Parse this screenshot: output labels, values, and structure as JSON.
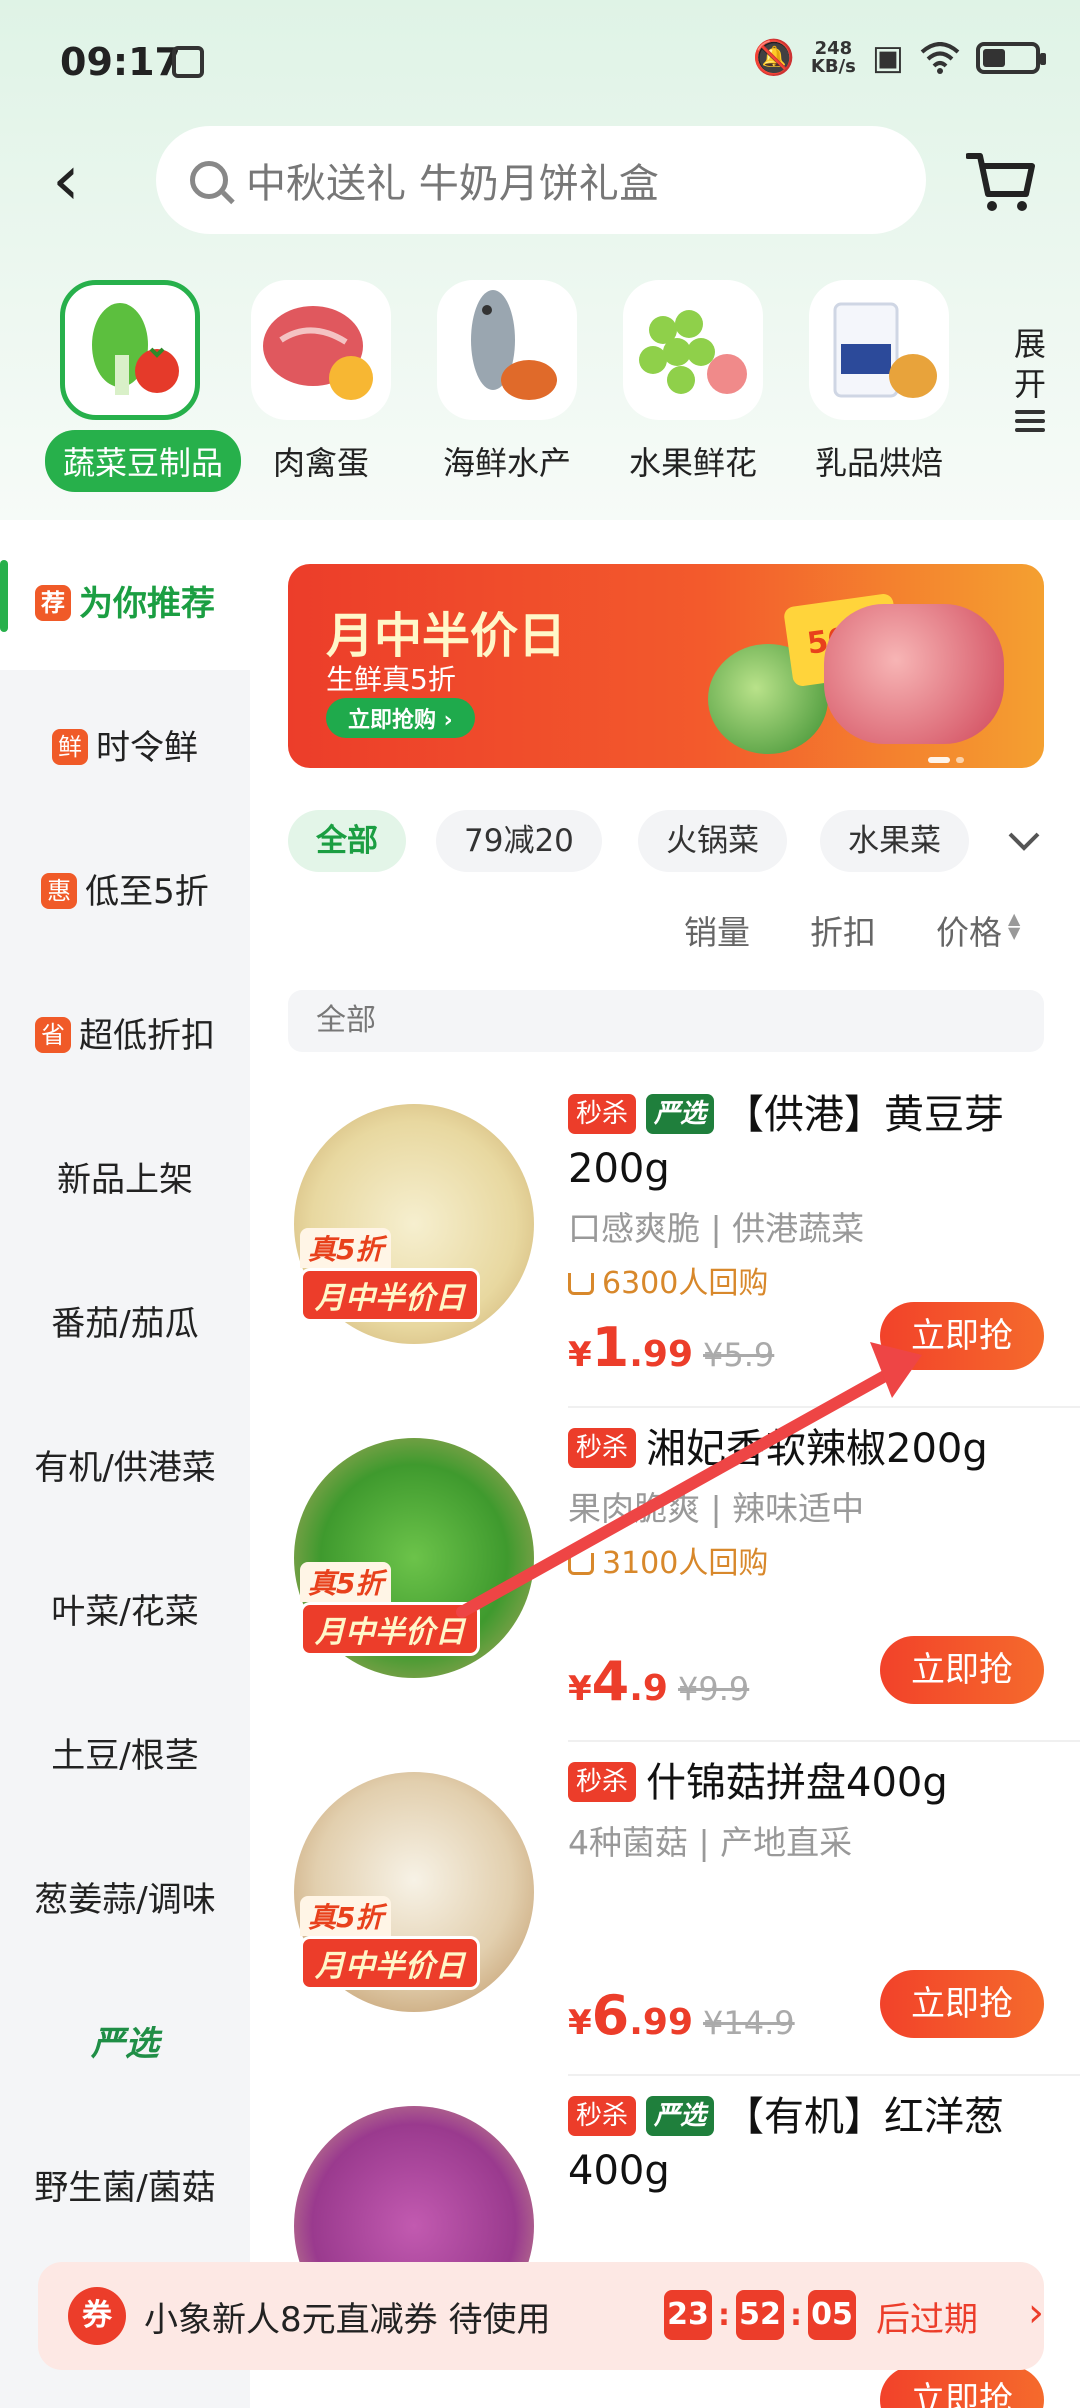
{
  "status_bar": {
    "time": "09:17",
    "speed": "248",
    "speed_unit": "KB/s"
  },
  "search": {
    "placeholder": "中秋送礼 牛奶月饼礼盒"
  },
  "categories": [
    {
      "label": "蔬菜豆制品",
      "active": true
    },
    {
      "label": "肉禽蛋",
      "active": false
    },
    {
      "label": "海鲜水产",
      "active": false
    },
    {
      "label": "水果鲜花",
      "active": false
    },
    {
      "label": "乳品烘焙",
      "active": false
    }
  ],
  "expand_label": "展开",
  "sidebar": {
    "items": [
      {
        "label": "为你推荐",
        "tag": "荐"
      },
      {
        "label": "时令鲜",
        "tag": "鲜"
      },
      {
        "label": "低至5折",
        "tag": "惠"
      },
      {
        "label": "超低折扣",
        "tag": "省"
      },
      {
        "label": "新品上架",
        "tag": ""
      },
      {
        "label": "番茄/茄瓜",
        "tag": ""
      },
      {
        "label": "有机/供港菜",
        "tag": ""
      },
      {
        "label": "叶菜/花菜",
        "tag": ""
      },
      {
        "label": "土豆/根茎",
        "tag": ""
      },
      {
        "label": "葱姜蒜/调味",
        "tag": ""
      },
      {
        "label": "严选",
        "tag": ""
      },
      {
        "label": "野生菌/菌菇",
        "tag": ""
      }
    ]
  },
  "banner": {
    "title": "月中半价日",
    "subtitle": "生鲜真5折",
    "button": "立即抢购 ›",
    "badge": "50%"
  },
  "chips": [
    "全部",
    "79减20",
    "火锅菜",
    "水果菜"
  ],
  "sorts": [
    "销量",
    "折扣",
    "价格"
  ],
  "section_header": "全部",
  "stamp": {
    "top": "真5折",
    "bottom": "月中半价日"
  },
  "badges": {
    "miaosha": "秒杀",
    "yanxuan": "严选"
  },
  "products": [
    {
      "title": "【供港】黄豆芽200g",
      "miaosha": true,
      "yanxuan": true,
      "desc": "口感爽脆 | 供港蔬菜",
      "rebuy": "6300人回购",
      "price_int": "1",
      "price_dec": ".99",
      "old_price": "¥5.9",
      "buy": "立即抢"
    },
    {
      "title": "湘妃香软辣椒200g",
      "miaosha": true,
      "yanxuan": false,
      "desc": "果肉脆爽 | 辣味适中",
      "rebuy": "3100人回购",
      "price_int": "4",
      "price_dec": ".9",
      "old_price": "¥9.9",
      "buy": "立即抢"
    },
    {
      "title": "什锦菇拼盘400g",
      "miaosha": true,
      "yanxuan": false,
      "desc": "4种菌菇 | 产地直采",
      "rebuy": "",
      "price_int": "6",
      "price_dec": ".99",
      "old_price": "¥14.9",
      "buy": "立即抢"
    },
    {
      "title": "【有机】红洋葱400g",
      "miaosha": true,
      "yanxuan": true,
      "desc": "",
      "rebuy": "",
      "price_int": "",
      "price_dec": "",
      "old_price": "",
      "buy": "立即抢"
    }
  ],
  "coupon": {
    "icon": "券",
    "text": "小象新人8元直减券 待使用",
    "hh": "23",
    "mm": "52",
    "ss": "05",
    "expire": "后过期"
  },
  "colors": {
    "brand_green": "#27b04b",
    "accent_red": "#ec3d2a",
    "rebuy_orange": "#d8882b"
  }
}
